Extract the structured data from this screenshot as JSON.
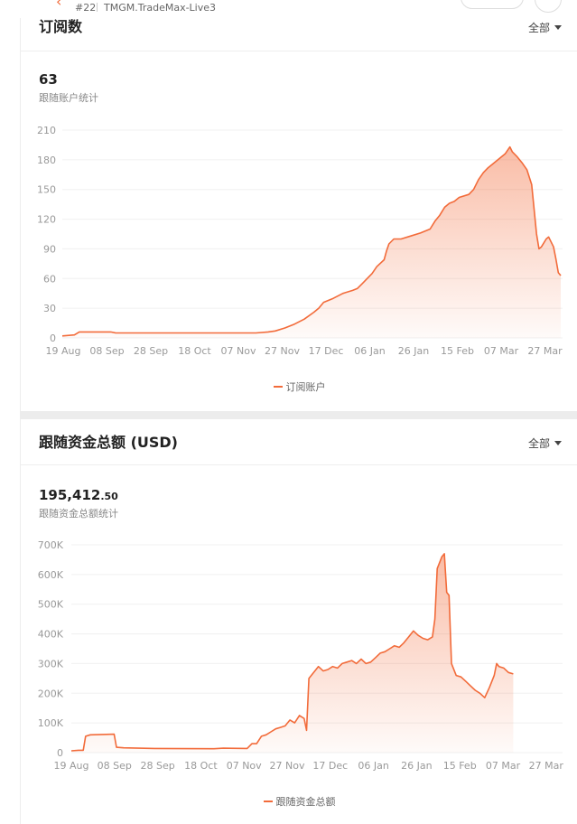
{
  "header": {
    "rank": "#22",
    "account": "TMGM.TradeMax-Live3"
  },
  "colors": {
    "accent": "#f26b3a",
    "grid": "#f0f0f0"
  },
  "icons": {
    "back": "chevron-left-icon",
    "dropdown": "caret-down-icon"
  },
  "subscriptions": {
    "title": "订阅数",
    "filter": "全部",
    "value": "63",
    "value_label": "跟随账户统计",
    "legend": "订阅账户"
  },
  "funds": {
    "title": "跟随资金总额 (USD)",
    "filter": "全部",
    "value_main": "195,412",
    "value_decimal": ".50",
    "value_label": "跟随资金总额统计",
    "legend": "跟随资金总额"
  },
  "chart_data": [
    {
      "type": "area",
      "x_ticks": [
        "19 Aug",
        "08 Sep",
        "28 Sep",
        "18 Oct",
        "07 Nov",
        "27 Nov",
        "17 Dec",
        "06 Jan",
        "26 Jan",
        "15 Feb",
        "07 Mar",
        "27 Mar"
      ],
      "y_ticks": [
        "0",
        "30",
        "60",
        "90",
        "120",
        "150",
        "180",
        "210"
      ],
      "ylim": [
        0,
        210
      ],
      "series": [
        {
          "name": "订阅账户",
          "points": [
            [
              0,
              2
            ],
            [
              5,
              3
            ],
            [
              7,
              6
            ],
            [
              10,
              6
            ],
            [
              20,
              6
            ],
            [
              22,
              5
            ],
            [
              40,
              5
            ],
            [
              60,
              5
            ],
            [
              80,
              5
            ],
            [
              85,
              6
            ],
            [
              88,
              7
            ],
            [
              92,
              10
            ],
            [
              96,
              14
            ],
            [
              100,
              19
            ],
            [
              104,
              26
            ],
            [
              106,
              30
            ],
            [
              108,
              36
            ],
            [
              112,
              40
            ],
            [
              116,
              45
            ],
            [
              120,
              48
            ],
            [
              122,
              50
            ],
            [
              124,
              55
            ],
            [
              126,
              60
            ],
            [
              128,
              65
            ],
            [
              130,
              72
            ],
            [
              133,
              79
            ],
            [
              134,
              88
            ],
            [
              135,
              95
            ],
            [
              137,
              100
            ],
            [
              140,
              100
            ],
            [
              144,
              103
            ],
            [
              148,
              106
            ],
            [
              152,
              110
            ],
            [
              154,
              118
            ],
            [
              156,
              124
            ],
            [
              158,
              132
            ],
            [
              160,
              136
            ],
            [
              162,
              138
            ],
            [
              164,
              142
            ],
            [
              168,
              145
            ],
            [
              170,
              150
            ],
            [
              172,
              160
            ],
            [
              174,
              167
            ],
            [
              176,
              172
            ],
            [
              178,
              176
            ],
            [
              180,
              180
            ],
            [
              183,
              186
            ],
            [
              185,
              193
            ],
            [
              186,
              188
            ],
            [
              188,
              183
            ],
            [
              190,
              177
            ],
            [
              192,
              170
            ],
            [
              194,
              155
            ],
            [
              195,
              130
            ],
            [
              196,
              105
            ],
            [
              197,
              90
            ],
            [
              198,
              92
            ],
            [
              200,
              100
            ],
            [
              201,
              102
            ],
            [
              203,
              92
            ],
            [
              204,
              80
            ],
            [
              205,
              66
            ],
            [
              206,
              63
            ]
          ]
        }
      ]
    },
    {
      "type": "area",
      "x_ticks": [
        "19 Aug",
        "08 Sep",
        "28 Sep",
        "18 Oct",
        "07 Nov",
        "27 Nov",
        "17 Dec",
        "06 Jan",
        "26 Jan",
        "15 Feb",
        "07 Mar",
        "27 Mar"
      ],
      "y_ticks": [
        "0",
        "100K",
        "200K",
        "300K",
        "400K",
        "500K",
        "600K",
        "700K"
      ],
      "ylim": [
        0,
        700000
      ],
      "series": [
        {
          "name": "跟随资金总额",
          "points": [
            [
              0,
              6000
            ],
            [
              3,
              8000
            ],
            [
              5,
              8000
            ],
            [
              6,
              55000
            ],
            [
              8,
              60000
            ],
            [
              18,
              62000
            ],
            [
              19,
              18000
            ],
            [
              22,
              16000
            ],
            [
              35,
              14000
            ],
            [
              60,
              13000
            ],
            [
              64,
              15000
            ],
            [
              74,
              14000
            ],
            [
              76,
              30000
            ],
            [
              78,
              30000
            ],
            [
              80,
              55000
            ],
            [
              82,
              60000
            ],
            [
              84,
              70000
            ],
            [
              86,
              80000
            ],
            [
              88,
              85000
            ],
            [
              90,
              90000
            ],
            [
              92,
              110000
            ],
            [
              94,
              100000
            ],
            [
              96,
              125000
            ],
            [
              98,
              115000
            ],
            [
              99,
              75000
            ],
            [
              100,
              250000
            ],
            [
              102,
              270000
            ],
            [
              104,
              290000
            ],
            [
              106,
              275000
            ],
            [
              108,
              280000
            ],
            [
              110,
              290000
            ],
            [
              112,
              285000
            ],
            [
              114,
              300000
            ],
            [
              116,
              305000
            ],
            [
              118,
              310000
            ],
            [
              120,
              300000
            ],
            [
              122,
              315000
            ],
            [
              124,
              300000
            ],
            [
              126,
              305000
            ],
            [
              128,
              320000
            ],
            [
              130,
              335000
            ],
            [
              132,
              340000
            ],
            [
              134,
              350000
            ],
            [
              136,
              360000
            ],
            [
              138,
              355000
            ],
            [
              140,
              370000
            ],
            [
              142,
              390000
            ],
            [
              144,
              410000
            ],
            [
              146,
              395000
            ],
            [
              148,
              385000
            ],
            [
              150,
              380000
            ],
            [
              152,
              390000
            ],
            [
              153,
              450000
            ],
            [
              154,
              620000
            ],
            [
              156,
              660000
            ],
            [
              157,
              670000
            ],
            [
              158,
              540000
            ],
            [
              159,
              530000
            ],
            [
              160,
              300000
            ],
            [
              162,
              260000
            ],
            [
              164,
              255000
            ],
            [
              166,
              240000
            ],
            [
              168,
              225000
            ],
            [
              170,
              210000
            ],
            [
              172,
              200000
            ],
            [
              174,
              185000
            ],
            [
              176,
              220000
            ],
            [
              178,
              260000
            ],
            [
              179,
              300000
            ],
            [
              180,
              290000
            ],
            [
              182,
              285000
            ],
            [
              184,
              270000
            ],
            [
              186,
              265000
            ]
          ]
        }
      ]
    }
  ]
}
